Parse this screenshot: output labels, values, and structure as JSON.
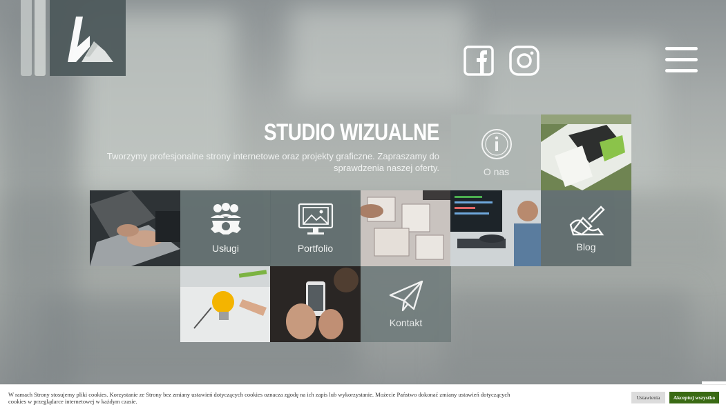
{
  "social": {
    "facebook": "facebook-icon",
    "instagram": "instagram-icon"
  },
  "hero": {
    "title": "STUDIO WIZUALNE",
    "subtitle": "Tworzymy profesjonalne strony internetowe oraz projekty graficzne. Zapraszamy do sprawdzenia naszej oferty."
  },
  "tiles": {
    "o_nas": "O nas",
    "uslugi": "Usługi",
    "portfolio": "Portfolio",
    "blog": "Blog",
    "kontakt": "Kontakt"
  },
  "cookie": {
    "text": "W ramach Strony stosujemy pliki cookies. Korzystanie ze Strony bez zmiany ustawień dotyczących cookies oznacza zgodę na ich zapis lub wykorzystanie. Możecie Państwo dokonać zmiany ustawień dotyczących cookies w przeglądarce internetowej w każdym czasie.",
    "settings_label": "Ustawienia",
    "accept_label": "Akceptuj wszystko"
  },
  "colors": {
    "accept": "#3a6a14",
    "tile_dark": "#5f6c6d"
  }
}
